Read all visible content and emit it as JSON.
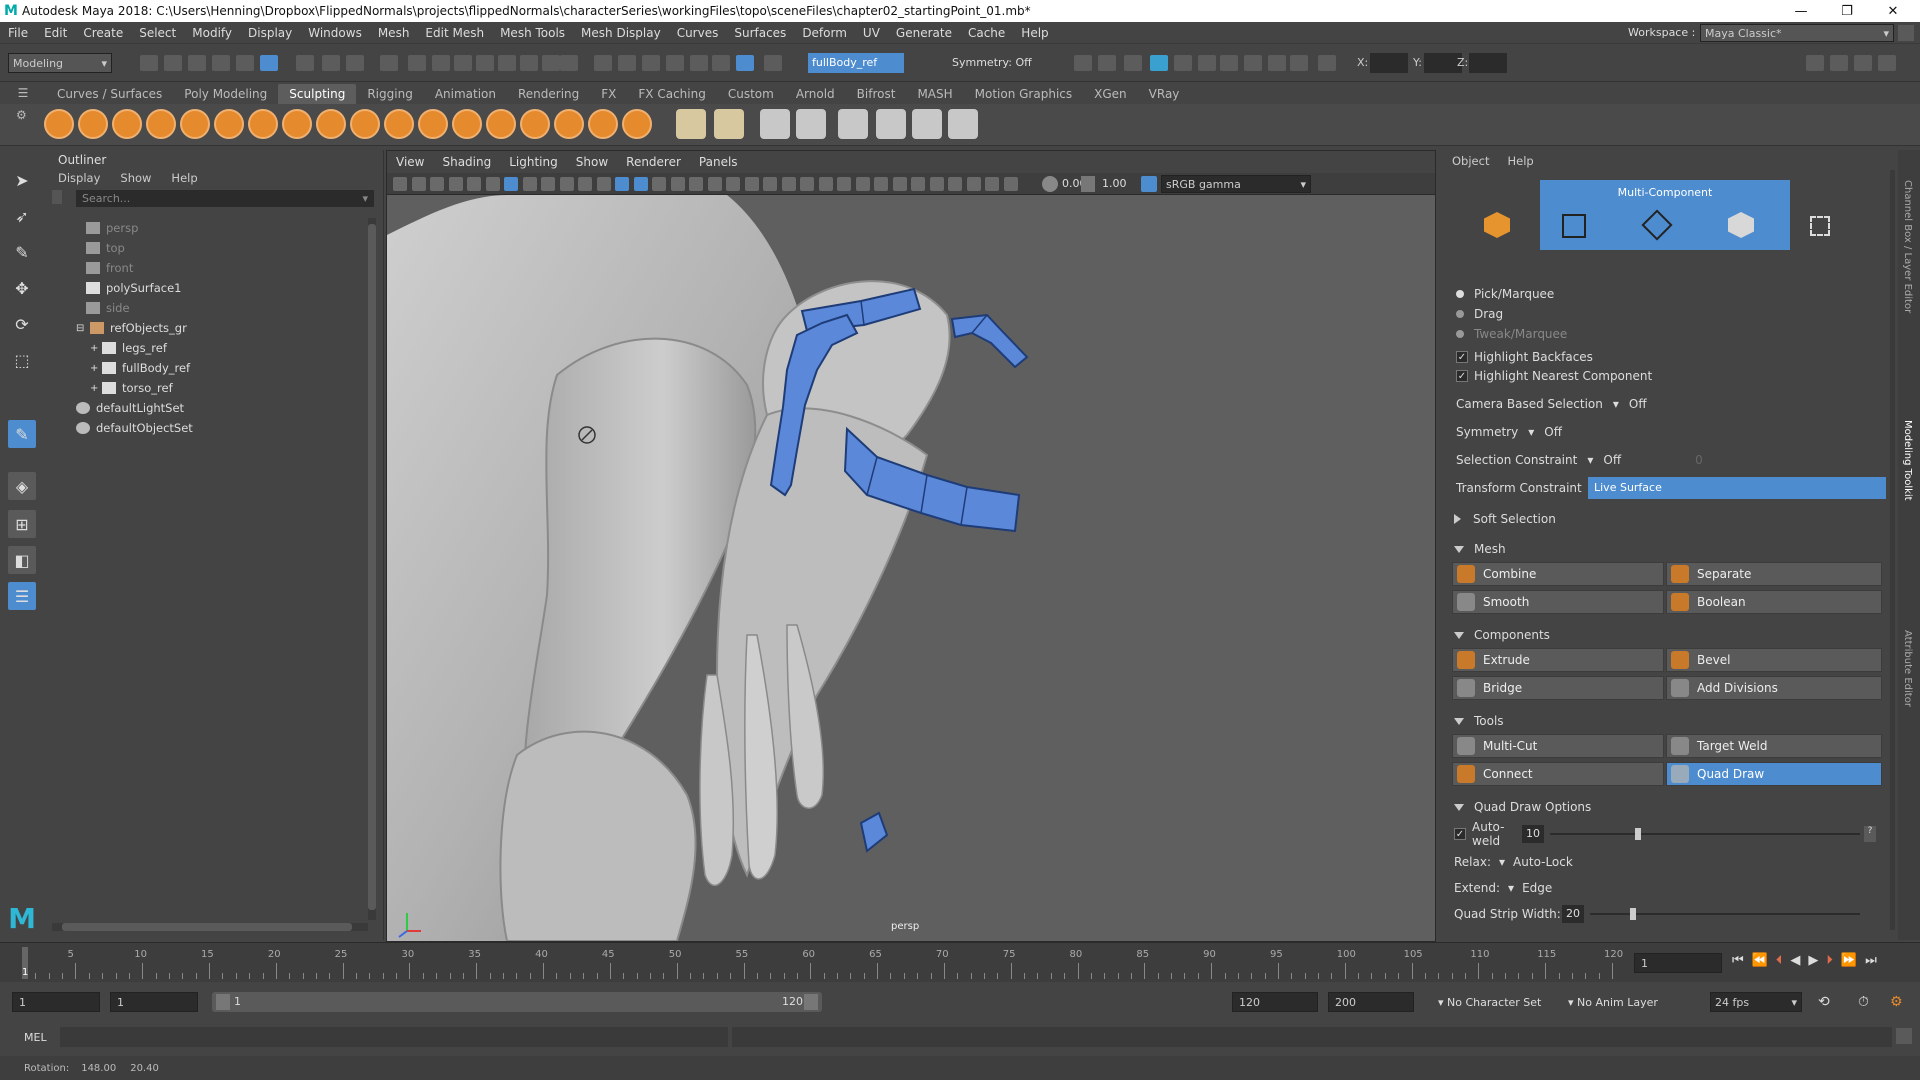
{
  "titlebar": {
    "title": "Autodesk Maya 2018: C:\\Users\\Henning\\Dropbox\\FlippedNormals\\projects\\flippedNormals\\characterSeries\\workingFiles\\topo\\sceneFiles\\chapter02_startingPoint_01.mb*"
  },
  "menu": [
    "File",
    "Edit",
    "Create",
    "Select",
    "Modify",
    "Display",
    "Windows",
    "Mesh",
    "Edit Mesh",
    "Mesh Tools",
    "Mesh Display",
    "Curves",
    "Surfaces",
    "Deform",
    "UV",
    "Generate",
    "Cache",
    "Help"
  ],
  "workspace": {
    "label": "Workspace :",
    "value": "Maya Classic*"
  },
  "statusline": {
    "mode": "Modeling",
    "object_field": "fullBody_ref",
    "symmetry": "Symmetry: Off",
    "x_label": "X:",
    "y_label": "Y:",
    "z_label": "Z:"
  },
  "shelf_tabs": [
    "Curves / Surfaces",
    "Poly Modeling",
    "Sculpting",
    "Rigging",
    "Animation",
    "Rendering",
    "FX",
    "FX Caching",
    "Custom",
    "Arnold",
    "Bifrost",
    "MASH",
    "Motion Graphics",
    "XGen",
    "VRay"
  ],
  "outliner": {
    "title": "Outliner",
    "menu": [
      "Display",
      "Show",
      "Help"
    ],
    "search_placeholder": "Search...",
    "items": [
      {
        "label": "persp",
        "dim": true
      },
      {
        "label": "top",
        "dim": true
      },
      {
        "label": "front",
        "dim": true
      },
      {
        "label": "polySurface1",
        "dim": false
      },
      {
        "label": "side",
        "dim": true
      },
      {
        "label": "refObjects_gr",
        "dim": false
      },
      {
        "label": "legs_ref",
        "dim": false
      },
      {
        "label": "fullBody_ref",
        "dim": false
      },
      {
        "label": "torso_ref",
        "dim": false
      },
      {
        "label": "defaultLightSet",
        "dim": false
      },
      {
        "label": "defaultObjectSet",
        "dim": false
      }
    ]
  },
  "viewport": {
    "menu": [
      "View",
      "Shading",
      "Lighting",
      "Show",
      "Renderer",
      "Panels"
    ],
    "exposure": "0.00",
    "gamma": "1.00",
    "colorspace": "sRGB gamma",
    "camera_label": "persp"
  },
  "modeling_toolkit": {
    "menu": [
      "Object",
      "Help"
    ],
    "multi_component": "Multi-Component",
    "pick_modes": [
      "Pick/Marquee",
      "Drag",
      "Tweak/Marquee"
    ],
    "highlight_backfaces": "Highlight Backfaces",
    "highlight_nearest": "Highlight Nearest Component",
    "camera_based_selection": {
      "label": "Camera Based Selection",
      "value": "Off"
    },
    "symmetry": {
      "label": "Symmetry",
      "value": "Off"
    },
    "selection_constraint": {
      "label": "Selection Constraint",
      "value": "Off",
      "extra": "0"
    },
    "transform_constraint": {
      "label": "Transform Constraint",
      "value": "Live Surface"
    },
    "soft_selection": "Soft Selection",
    "sections": {
      "mesh": {
        "title": "Mesh",
        "buttons": [
          "Combine",
          "Separate",
          "Smooth",
          "Boolean"
        ]
      },
      "components": {
        "title": "Components",
        "buttons": [
          "Extrude",
          "Bevel",
          "Bridge",
          "Add Divisions"
        ]
      },
      "tools": {
        "title": "Tools",
        "buttons": [
          "Multi-Cut",
          "Target Weld",
          "Connect",
          "Quad Draw"
        ]
      }
    },
    "quad_draw_options": {
      "title": "Quad Draw Options",
      "autoweld_label": "Auto-weld",
      "autoweld_value": "10",
      "autoweld_fraction": 0.28,
      "relax_label": "Relax:",
      "relax_value": "Auto-Lock",
      "extend_label": "Extend:",
      "extend_value": "Edge",
      "strip_label": "Quad Strip Width:",
      "strip_value": "20",
      "strip_fraction": 0.15
    },
    "side_tabs": [
      "Channel Box / Layer Editor",
      "Modeling Toolkit",
      "Attribute Editor"
    ]
  },
  "timeline": {
    "ticks": [
      "5",
      "10",
      "15",
      "20",
      "25",
      "30",
      "35",
      "40",
      "45",
      "50",
      "55",
      "60",
      "65",
      "70",
      "75",
      "80",
      "85",
      "90",
      "95",
      "100",
      "105",
      "110",
      "115",
      "120"
    ],
    "current_frame": "1",
    "current_field": "1"
  },
  "range": {
    "start": "1",
    "anim_start": "1",
    "slider_start": "1",
    "slider_end": "120",
    "anim_end": "120",
    "end": "200",
    "character_set": "No Character Set",
    "anim_layer": "No Anim Layer",
    "fps": "24 fps"
  },
  "cmdline": {
    "label": "MEL"
  },
  "helpline": {
    "label": "Rotation:",
    "v1": "148.00",
    "v2": "20.40"
  },
  "colors": {
    "accent": "#4d8ccf",
    "highlight_blue": "#5b88d8",
    "shelf_orange": "#e68a2e"
  }
}
